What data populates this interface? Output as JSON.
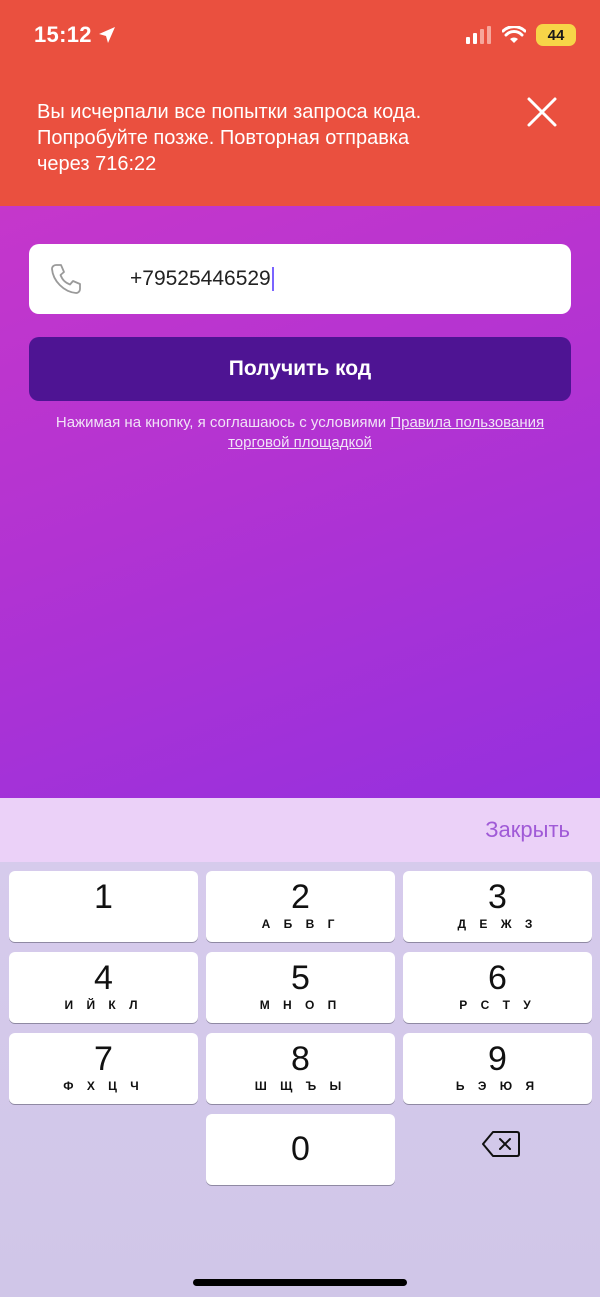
{
  "status_bar": {
    "time": "15:12",
    "battery": "44"
  },
  "banner": {
    "message": "Вы исчерпали все попытки запроса кода.\nПопробуйте позже.  Повторная отправка\nчерез 716:22"
  },
  "phone_input": {
    "value": "+79525446529"
  },
  "get_code_button": {
    "label": "Получить код"
  },
  "terms": {
    "prefix": "Нажимая на кнопку, я соглашаюсь с условиями ",
    "link": "Правила пользования торговой площадкой"
  },
  "keyboard": {
    "close_label": "Закрыть",
    "keys": [
      {
        "digit": "1",
        "letters": ""
      },
      {
        "digit": "2",
        "letters": "А Б В Г"
      },
      {
        "digit": "3",
        "letters": "Д Е Ж З"
      },
      {
        "digit": "4",
        "letters": "И Й К Л"
      },
      {
        "digit": "5",
        "letters": "М Н О П"
      },
      {
        "digit": "6",
        "letters": "Р С Т У"
      },
      {
        "digit": "7",
        "letters": "Ф Х Ц Ч"
      },
      {
        "digit": "8",
        "letters": "Ш Щ Ъ Ы"
      },
      {
        "digit": "9",
        "letters": "Ь Э Ю Я"
      },
      {
        "digit": "0",
        "letters": ""
      }
    ]
  },
  "colors": {
    "banner": "#ea503f",
    "button": "#4e1493",
    "gradient_start": "#c537cb",
    "gradient_end": "#9530de",
    "close_text": "#a05ad7"
  },
  "icons": [
    "location-arrow-icon",
    "signal-icon",
    "wifi-icon",
    "close-icon",
    "phone-icon",
    "backspace-icon"
  ]
}
